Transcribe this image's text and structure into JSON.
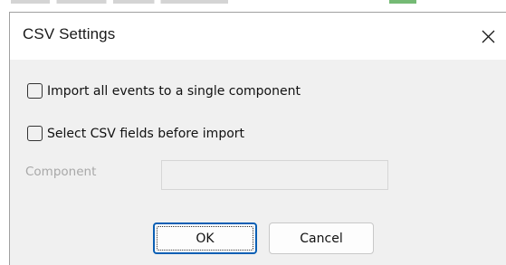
{
  "dialog": {
    "title": "CSV Settings",
    "close_icon": "close-icon"
  },
  "options": [
    {
      "label": "Import all events to a single component",
      "checked": false
    },
    {
      "label": "Select CSV fields before import",
      "checked": false
    }
  ],
  "component": {
    "label": "Component",
    "value": "",
    "enabled": false
  },
  "buttons": {
    "ok_label": "OK",
    "cancel_label": "Cancel"
  },
  "colors": {
    "dialog_bg": "#f0f0f0",
    "titlebar_bg": "#ffffff",
    "default_button_border": "#0a5fb4",
    "disabled_text": "#a8a8a8"
  }
}
